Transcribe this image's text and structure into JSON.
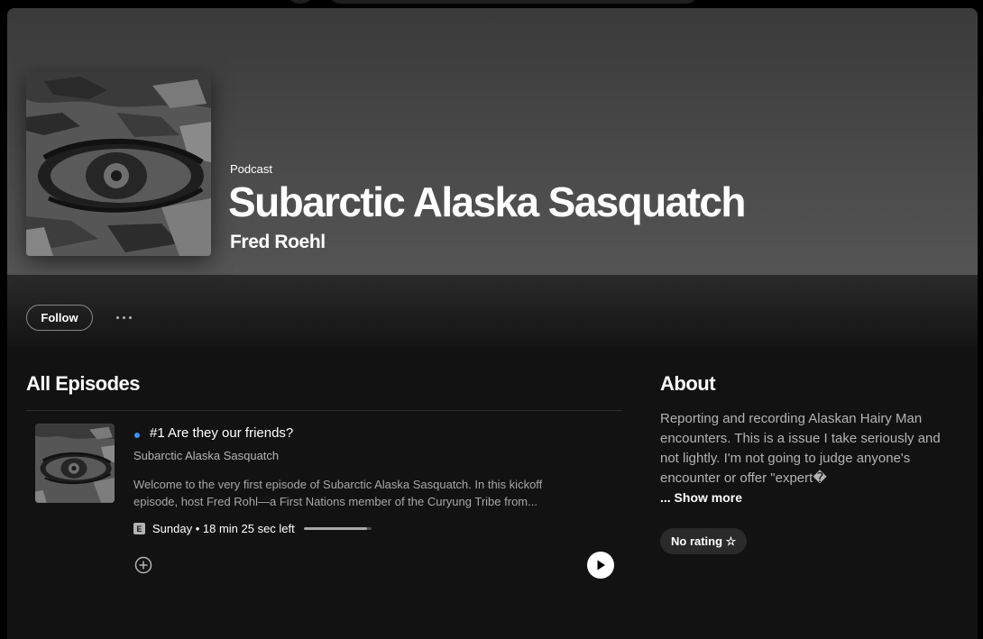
{
  "podcast": {
    "type_label": "Podcast",
    "title": "Subarctic Alaska Sasquatch",
    "author": "Fred Roehl",
    "follow_label": "Follow"
  },
  "episodes": {
    "section_title": "All Episodes",
    "items": [
      {
        "title": "#1 Are they our friends?",
        "show": "Subarctic Alaska Sasquatch",
        "description_line1": "Welcome to the very first episode of Subarctic Alaska Sasquatch. In this kickoff",
        "description_line2": "episode, host Fred Rohl—a First Nations member of the Curyung Tribe from...",
        "explicit_badge": "E",
        "meta": "Sunday • 18 min 25 sec left",
        "progress_fraction": 0.93,
        "unplayed": true
      }
    ]
  },
  "about": {
    "section_title": "About",
    "description": "Reporting and recording Alaskan Hairy Man encounters. This is a issue I take seriously and not lightly. I'm not going to judge anyone's encounter or offer \"expert�",
    "show_more": "... Show more",
    "rating_label": "No rating ☆"
  },
  "icons": {
    "more": "more-options-icon",
    "add": "add-circle-icon",
    "play": "play-icon",
    "star": "star-outline-icon"
  },
  "colors": {
    "accent_dot": "#3d91f4",
    "background": "#121212",
    "header": "#535353"
  }
}
